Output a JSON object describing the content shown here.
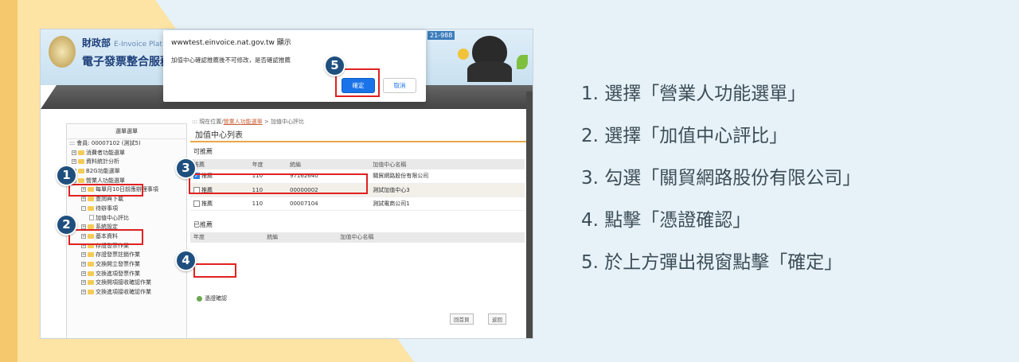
{
  "banner": {
    "ministry": "財政部",
    "ministry_sub": "E-Invoice Plat",
    "platform": "電子發票整合服務",
    "hotline": "21-988"
  },
  "dialog": {
    "title": "wwwtest.einvoice.nat.gov.tw 顯示",
    "message": "加值中心確認推薦後不可修改，是否確認推薦",
    "ok_label": "確定",
    "cancel_label": "取消"
  },
  "sidebar": {
    "header": "選單選單",
    "items": [
      {
        "label": "::: 會員: 00007102 (測試5)",
        "type": "root"
      },
      {
        "label": "消費者功能選單",
        "type": "folder"
      },
      {
        "label": "資料統計分析",
        "type": "folder"
      },
      {
        "label": "B2G功能選單",
        "type": "folder"
      },
      {
        "label": "營業人功能選單",
        "type": "folder-open"
      },
      {
        "label": "每單月10日前應辦理事項",
        "type": "sub"
      },
      {
        "label": "查詢與下載",
        "type": "sub"
      },
      {
        "label": "待辦事項",
        "type": "sub"
      },
      {
        "label": "加值中心評比",
        "type": "page"
      },
      {
        "label": "系統設定",
        "type": "sub"
      },
      {
        "label": "基本資料",
        "type": "sub"
      },
      {
        "label": "存證發票作業",
        "type": "sub"
      },
      {
        "label": "存證發票註銷作業",
        "type": "sub"
      },
      {
        "label": "交換開立發票作業",
        "type": "sub"
      },
      {
        "label": "交換進項發票作業",
        "type": "sub"
      },
      {
        "label": "交換開項接收確認作業",
        "type": "sub"
      },
      {
        "label": "交換進項接收確認作業",
        "type": "sub"
      }
    ]
  },
  "content": {
    "breadcrumb_prefix": "::: 現在位置/",
    "breadcrumb_link": "營業人功能選單",
    "breadcrumb_suffix": " > 加值中心評比",
    "title": "加值中心列表",
    "available_label": "可推薦",
    "recommended_label": "已推薦",
    "columns": [
      "推薦",
      "年度",
      "統編",
      "加值中心名稱"
    ],
    "rows": [
      {
        "check": "推薦",
        "year": "110",
        "id": "97162640",
        "name": "關貿網路股份有限公司",
        "checked": true
      },
      {
        "check": "推薦",
        "year": "110",
        "id": "00000002",
        "name": "測試加值中心3",
        "checked": false
      },
      {
        "check": "推薦",
        "year": "110",
        "id": "00007104",
        "name": "測試電商公司1",
        "checked": false
      }
    ],
    "confirm_label": "憑證確認",
    "pager_first": "回首頁",
    "pager_back": "返回"
  },
  "badges": [
    "1",
    "2",
    "3",
    "4",
    "5"
  ],
  "steps": [
    "1. 選擇「營業人功能選單」",
    "2. 選擇「加值中心評比」",
    "3. 勾選「關貿網路股份有限公司」",
    "4. 點擊「憑證確認」",
    "5. 於上方彈出視窗點擊「確定」"
  ]
}
